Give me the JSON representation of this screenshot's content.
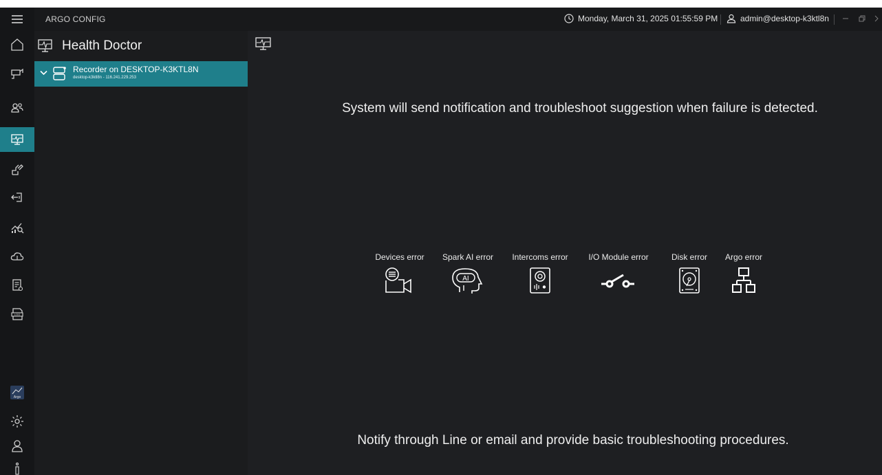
{
  "app": {
    "title": "ARGO CONFIG"
  },
  "titlebar": {
    "datetime": "Monday, March 31, 2025 01:55:59 PM",
    "user": "admin@desktop-k3ktl8n",
    "icons": [
      "menu-icon",
      "clock-icon",
      "user-icon",
      "minimize-icon",
      "restore-icon",
      "close-icon"
    ]
  },
  "sidebar": {
    "items": [
      {
        "name": "home",
        "icon": "home-icon"
      },
      {
        "name": "devices",
        "icon": "camera-icon"
      },
      {
        "name": "users",
        "icon": "people-icon"
      },
      {
        "name": "health-doctor",
        "icon": "monitor-pulse-icon",
        "active": true
      },
      {
        "name": "tools",
        "icon": "tools-icon"
      },
      {
        "name": "io",
        "icon": "io-icon"
      },
      {
        "name": "analytics",
        "icon": "chart-search-icon"
      },
      {
        "name": "cloud",
        "icon": "cloud-icon"
      },
      {
        "name": "reports",
        "icon": "report-icon"
      },
      {
        "name": "logs",
        "icon": "log-icon"
      }
    ],
    "bottom_items": [
      {
        "name": "argo",
        "icon": "argo-icon",
        "label": "Argo"
      },
      {
        "name": "settings",
        "icon": "gear-icon"
      },
      {
        "name": "account",
        "icon": "user-icon"
      },
      {
        "name": "info",
        "icon": "info-icon"
      }
    ]
  },
  "tree": {
    "title": "Health Doctor",
    "node": {
      "name": "Recorder on DESKTOP-K3KTL8N",
      "subtitle": "desktop-k3ktl8n - 116.241.229.253"
    }
  },
  "main": {
    "headline": "System will send notification and troubleshoot suggestion when failure is detected.",
    "footer": "Notify through Line or email and provide basic troubleshooting procedures.",
    "errors": [
      {
        "label": "Devices error",
        "icon": "camera-list-icon"
      },
      {
        "label": "Spark AI error",
        "icon": "ai-head-icon"
      },
      {
        "label": "Intercoms error",
        "icon": "intercom-icon"
      },
      {
        "label": "I/O Module error",
        "icon": "switch-icon"
      },
      {
        "label": "Disk error",
        "icon": "hard-disk-icon"
      },
      {
        "label": "Argo error",
        "icon": "network-icon"
      }
    ]
  },
  "colors": {
    "accent": "#1f7f8b",
    "background": "#1e1f22",
    "rail": "#151618"
  }
}
